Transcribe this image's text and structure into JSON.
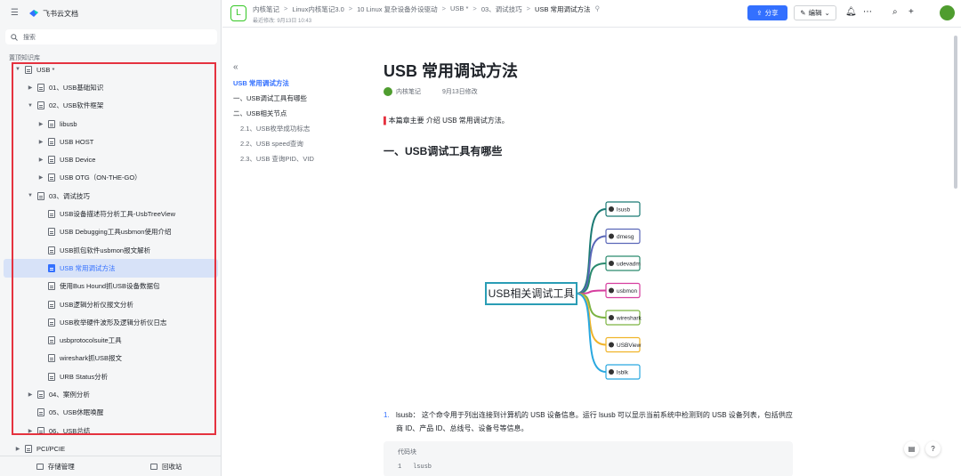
{
  "sidebar": {
    "brand": "飞书云文档",
    "search_placeholder": "搜索",
    "section": "置顶知识库",
    "tree": [
      {
        "label": "USB *",
        "arrow": "▼"
      },
      {
        "label": "01、USB基础知识",
        "arrow": "▶"
      },
      {
        "label": "02、USB软件框架",
        "arrow": "▼"
      },
      {
        "label": "libusb",
        "arrow": "▶"
      },
      {
        "label": "USB HOST",
        "arrow": "▶"
      },
      {
        "label": "USB Device",
        "arrow": "▶"
      },
      {
        "label": "USB OTG（ON-THE-GO）",
        "arrow": "▶"
      },
      {
        "label": "03、调试技巧",
        "arrow": "▼"
      },
      {
        "label": "USB设备描述符分析工具-UsbTreeView",
        "arrow": ""
      },
      {
        "label": "USB Debugging工具usbmon使用介绍",
        "arrow": ""
      },
      {
        "label": "USB抓包软件usbmon报文解析",
        "arrow": ""
      },
      {
        "label": "USB 常用调试方法",
        "arrow": ""
      },
      {
        "label": "使用Bus Hound抓USB设备数据包",
        "arrow": ""
      },
      {
        "label": "USB逻辑分析仪报文分析",
        "arrow": ""
      },
      {
        "label": "USB枚举硬件波形及逻辑分析仪日志",
        "arrow": ""
      },
      {
        "label": "usbprotocolsuite工具",
        "arrow": ""
      },
      {
        "label": "wireshark抓USB报文",
        "arrow": ""
      },
      {
        "label": "URB Status分析",
        "arrow": ""
      },
      {
        "label": "04、案例分析",
        "arrow": "▶"
      },
      {
        "label": "05、USB休眠唤醒",
        "arrow": ""
      },
      {
        "label": "06、USB总结",
        "arrow": "▶"
      },
      {
        "label": "PCI/PCIE",
        "arrow": "▶"
      }
    ],
    "bottom": {
      "storage": "存储管理",
      "trash": "回收站"
    }
  },
  "header": {
    "crumbs": [
      "内核笔记",
      "Linux内核笔记3.0",
      "10 Linux 复杂设备外设驱动",
      "USB *",
      "03、调试技巧",
      "USB 常用调试方法"
    ],
    "edited": "最近修改: 9月13日 10:43",
    "share": "分享",
    "edit": "编辑"
  },
  "outline": {
    "items": [
      "USB 常用调试方法",
      "一、USB调试工具有哪些",
      "二、USB相关节点",
      "2.1、USB枚举成功标志",
      "2.2、USB speed查询",
      "2.3、USB 查询PID、VID"
    ]
  },
  "doc": {
    "title": "USB 常用调试方法",
    "author": "内核笔记",
    "date": "9月13日修改",
    "intro": "本篇章主要 介绍 USB 常用调试方法。",
    "section1": "一、USB调试工具有哪些",
    "mindmap": {
      "center": "USB相关调试工具",
      "branches": [
        {
          "label": "lsusb",
          "color": "#1b7a74"
        },
        {
          "label": "dmesg",
          "color": "#5a67b8"
        },
        {
          "label": "udevadm",
          "color": "#2a8a6e"
        },
        {
          "label": "usbmon",
          "color": "#d63d9e"
        },
        {
          "label": "wireshark",
          "color": "#7cb342"
        },
        {
          "label": "USBView",
          "color": "#f0b429"
        },
        {
          "label": "lsblk",
          "color": "#29a8e0"
        }
      ]
    },
    "list1_num": "1.",
    "list1_text": "lsusb： 这个命令用于列出连接到计算机的 USB 设备信息。运行 lsusb 可以显示当前系统中检测到的 USB 设备列表，包括供应商 ID、产品 ID、总线号、设备号等信息。",
    "code_label": "代码块",
    "code_line": "1",
    "code_text": "lsusb"
  }
}
